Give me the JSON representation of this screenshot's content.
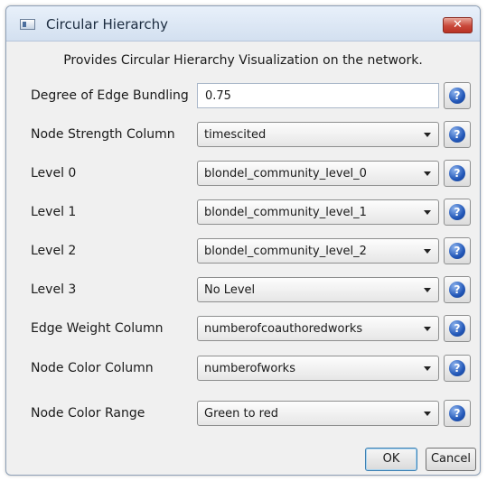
{
  "window": {
    "title": "Circular Hierarchy",
    "close_glyph": "✕",
    "icon": "window-app-icon"
  },
  "description": "Provides Circular Hierarchy Visualization on the network.",
  "fields": [
    {
      "label": "Degree of Edge Bundling",
      "type": "text",
      "value": "0.75"
    },
    {
      "label": "Node Strength Column",
      "type": "select",
      "value": "timescited"
    },
    {
      "label": "Level 0",
      "type": "select",
      "value": "blondel_community_level_0"
    },
    {
      "label": "Level 1",
      "type": "select",
      "value": "blondel_community_level_1"
    },
    {
      "label": "Level 2",
      "type": "select",
      "value": "blondel_community_level_2"
    },
    {
      "label": "Level 3",
      "type": "select",
      "value": "No Level"
    },
    {
      "label": "Edge Weight Column",
      "type": "select",
      "value": "numberofcoauthoredworks"
    },
    {
      "label": "Node Color Column",
      "type": "select",
      "value": "numberofworks"
    },
    {
      "label": "Node Color Range",
      "type": "select",
      "value": "Green to red"
    }
  ],
  "help_glyph": "?",
  "buttons": {
    "ok": "OK",
    "cancel": "Cancel"
  },
  "colors": {
    "titlebar": "#d3e0f0",
    "close_button": "#c9483a",
    "help_icon": "#2257b8",
    "ok_border": "#3c7fb1"
  }
}
